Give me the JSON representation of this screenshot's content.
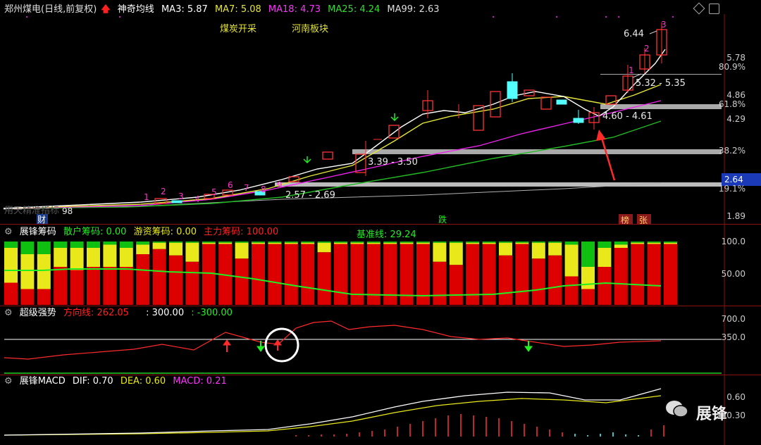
{
  "header": {
    "stock": "郑州煤电(日线,前复权)",
    "indicator": "神奇均线",
    "ma3": "MA3: 5.87",
    "ma7": "MA7: 5.08",
    "ma18": "MA18: 4.73",
    "ma25": "MA25: 4.24",
    "ma99": "MA99: 2.63"
  },
  "concepts": [
    "煤炭开采",
    "河南板块"
  ],
  "price_axis": [
    "5.78",
    "80.9%",
    "4.86",
    "61.8%",
    "4.29",
    "38.2%",
    "2.64",
    "19.1%",
    "1.89"
  ],
  "price_annotations": [
    "6.44",
    "5.32 - 5.35",
    "4.60 - 4.61",
    "3.39 - 3.50",
    "2.57 - 2.69",
    "98"
  ],
  "counts": [
    "1",
    "2",
    "3",
    "4",
    "5",
    "6",
    "7",
    "8",
    "9",
    "1",
    "2",
    "3"
  ],
  "events": {
    "cai": "财",
    "die": "跌",
    "bang": "榜",
    "zhang": "张"
  },
  "watermark_left": "用天精准指标",
  "chip_panel": {
    "title": "展锋筹码",
    "retail": "散户筹码: 0.00",
    "hot": "游资筹码: 0.00",
    "main": "主力筹码: 100.00",
    "base": "基准线: 29.24",
    "axis": [
      "100.0",
      "50.00"
    ]
  },
  "strong_panel": {
    "title": "超级强势",
    "direction": "方向线: 262.05",
    "v1": ": 300.00",
    "v2": ": -300.00",
    "axis": [
      "700.0",
      "350.0"
    ]
  },
  "macd_panel": {
    "title": "展锋MACD",
    "dif": "DIF: 0.70",
    "dea": "DEA: 0.60",
    "macd": "MACD: 0.21",
    "axis": [
      "0.60",
      "0.30"
    ]
  },
  "brand": "展锋",
  "colors": {
    "up": "#ff3333",
    "down": "#54ffff",
    "ma3": "#ffffff",
    "ma7": "#e5e53a",
    "ma18": "#ff33ff",
    "ma25": "#33cc33",
    "ma99": "#b0b0b0",
    "hot": "#e8e81a",
    "retail": "#10c010",
    "main": "#dd0000"
  }
}
